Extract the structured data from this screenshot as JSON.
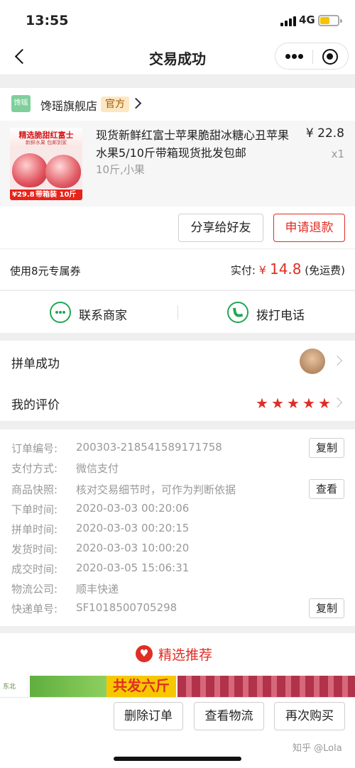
{
  "status_bar": {
    "time": "13:55",
    "network": "4G"
  },
  "nav": {
    "title": "交易成功"
  },
  "shop": {
    "logo_text": "馋瑶",
    "name": "馋瑶旗舰店",
    "official_badge": "官方"
  },
  "product": {
    "thumb_title": "精选脆甜红富士",
    "thumb_subtitle": "新鲜水果 包邮到家",
    "thumb_price": "¥29.8",
    "thumb_badge": "带箱装 10斤",
    "name": "现货新鲜红富士苹果脆甜冰糖心丑苹果水果5/10斤带箱现货批发包邮",
    "spec": "10斤,小果",
    "price": "¥ 22.8",
    "quantity": "x1"
  },
  "actions": {
    "share": "分享给好友",
    "refund": "申请退款"
  },
  "payment": {
    "coupon_text": "使用8元专属券",
    "paid_label": "实付: ",
    "currency": "¥ ",
    "amount": "14.8",
    "shipping_note": " (免运费)"
  },
  "contact": {
    "merchant": "联系商家",
    "phone": "拨打电话"
  },
  "status_rows": {
    "group_buy": "拼单成功",
    "my_review": "我的评价",
    "review_stars": 5
  },
  "order_info": {
    "rows": [
      {
        "label": "订单编号:",
        "value": "200303-218541589171758",
        "button": "复制"
      },
      {
        "label": "支付方式:",
        "value": "微信支付",
        "button": ""
      },
      {
        "label": "商品快照:",
        "value": "核对交易细节时，可作为判断依据",
        "button": "查看"
      },
      {
        "label": "下单时间:",
        "value": "2020-03-03 00:20:06",
        "button": ""
      },
      {
        "label": "拼单时间:",
        "value": "2020-03-03 00:20:15",
        "button": ""
      },
      {
        "label": "发货时间:",
        "value": "2020-03-03 10:00:20",
        "button": ""
      },
      {
        "label": "成交时间:",
        "value": "2020-03-05 15:06:31",
        "button": ""
      },
      {
        "label": "物流公司:",
        "value": "顺丰快递",
        "button": ""
      },
      {
        "label": "快递单号:",
        "value": "SF1018500705298",
        "button": "复制"
      }
    ]
  },
  "recommend": {
    "title": "精选推荐",
    "banner_left": "东北",
    "banner_text": "共发六斤"
  },
  "bottom_bar": {
    "delete": "删除订单",
    "logistics": "查看物流",
    "rebuy": "再次购买"
  },
  "watermark": "知乎 @Lola",
  "colors": {
    "accent": "#e02e24",
    "green": "#20a753",
    "star": "#e02e24"
  }
}
